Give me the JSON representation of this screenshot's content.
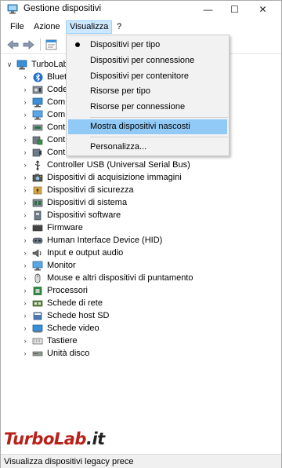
{
  "window": {
    "title": "Gestione dispositivi",
    "controls": {
      "minimize": "—",
      "maximize": "☐",
      "close": "✕"
    }
  },
  "menubar": {
    "items": [
      {
        "label": "File"
      },
      {
        "label": "Azione"
      },
      {
        "label": "Visualizza"
      },
      {
        "label": "?"
      }
    ],
    "active": "Visualizza"
  },
  "toolbar": {
    "buttons": [
      "back-arrow-icon",
      "forward-arrow-icon",
      "properties-icon"
    ]
  },
  "tree": {
    "root": {
      "label": "TurboLab"
    },
    "items": [
      {
        "label": "Bluetooth",
        "icon": "bluetooth-icon"
      },
      {
        "label": "Code",
        "icon": "audio-codec-icon"
      },
      {
        "label": "Com",
        "icon": "computer-icon"
      },
      {
        "label": "Com",
        "icon": "monitor-icon"
      },
      {
        "label": "Cont",
        "icon": "disk-controller-icon"
      },
      {
        "label": "Cont",
        "icon": "storage-controller-icon"
      },
      {
        "label": "Cont",
        "icon": "sound-controller-icon"
      },
      {
        "label": "Controller USB (Universal Serial Bus)",
        "icon": "usb-icon"
      },
      {
        "label": "Dispositivi di acquisizione immagini",
        "icon": "camera-icon"
      },
      {
        "label": "Dispositivi di sicurezza",
        "icon": "security-icon"
      },
      {
        "label": "Dispositivi di sistema",
        "icon": "system-device-icon"
      },
      {
        "label": "Dispositivi software",
        "icon": "software-device-icon"
      },
      {
        "label": "Firmware",
        "icon": "firmware-icon"
      },
      {
        "label": "Human Interface Device (HID)",
        "icon": "hid-icon"
      },
      {
        "label": "Input e output audio",
        "icon": "speaker-icon"
      },
      {
        "label": "Monitor",
        "icon": "monitor-icon"
      },
      {
        "label": "Mouse e altri dispositivi di puntamento",
        "icon": "mouse-icon"
      },
      {
        "label": "Processori",
        "icon": "processor-icon"
      },
      {
        "label": "Schede di rete",
        "icon": "network-icon"
      },
      {
        "label": "Schede host SD",
        "icon": "sd-icon"
      },
      {
        "label": "Schede video",
        "icon": "video-card-icon"
      },
      {
        "label": "Tastiere",
        "icon": "keyboard-icon"
      },
      {
        "label": "Unità disco",
        "icon": "disk-drive-icon"
      }
    ]
  },
  "dropdown": {
    "items": [
      {
        "label": "Dispositivi per tipo",
        "checked": true
      },
      {
        "label": "Dispositivi per connessione"
      },
      {
        "label": "Dispositivi per contenitore"
      },
      {
        "label": "Risorse per tipo"
      },
      {
        "label": "Risorse per connessione"
      },
      {
        "label": "Mostra dispositivi nascosti",
        "highlighted": true
      },
      {
        "label": "Personalizza..."
      }
    ]
  },
  "statusbar": {
    "text": "Visualizza dispositivi legacy prece"
  },
  "watermark": {
    "part1": "TurboLab",
    "part2": ".it"
  },
  "colors": {
    "menu_highlight": "#91c9f7",
    "active_menu": "#cce8ff",
    "accent": "#0078d7",
    "brand_red": "#b8201a"
  }
}
